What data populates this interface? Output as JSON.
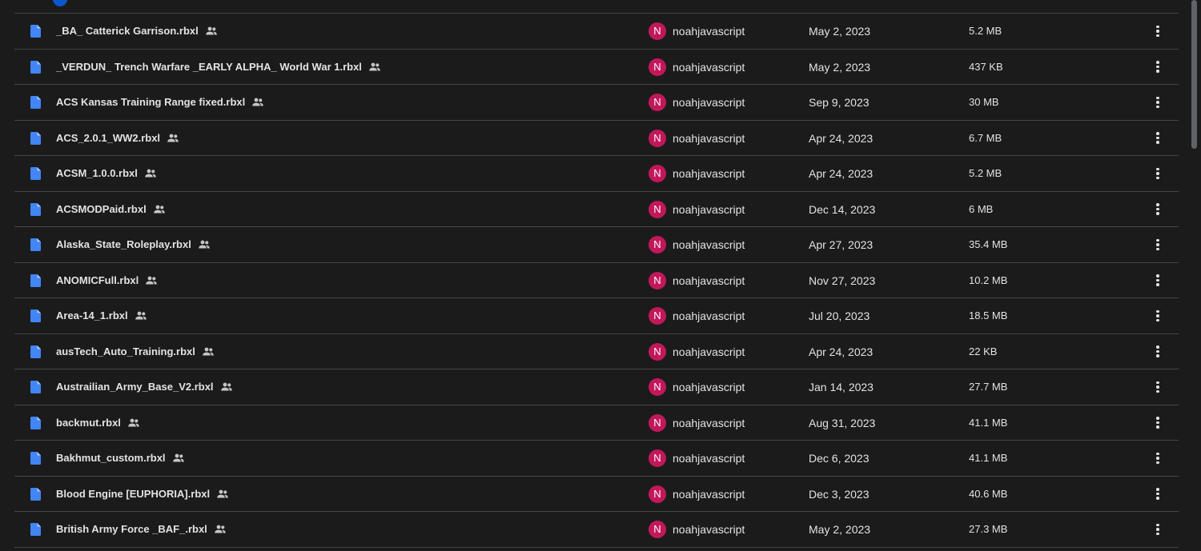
{
  "colors": {
    "background": "#1b1b1b",
    "divider": "#444746",
    "file_icon": "#4285f4",
    "avatar": "#c2185b",
    "text": "#e3e3e3"
  },
  "files": [
    {
      "name": "_BA_ Catterick Garrison.rbxl",
      "owner_initial": "N",
      "owner": "noahjavascript",
      "modified": "May 2, 2023",
      "size": "5.2 MB",
      "icon": "document-icon",
      "shared": true
    },
    {
      "name": "_VERDUN_ Trench Warfare _EARLY ALPHA_ World War 1.rbxl",
      "owner_initial": "N",
      "owner": "noahjavascript",
      "modified": "May 2, 2023",
      "size": "437 KB",
      "icon": "document-icon",
      "shared": true
    },
    {
      "name": "ACS Kansas Training Range fixed.rbxl",
      "owner_initial": "N",
      "owner": "noahjavascript",
      "modified": "Sep 9, 2023",
      "size": "30 MB",
      "icon": "document-icon",
      "shared": true
    },
    {
      "name": "ACS_2.0.1_WW2.rbxl",
      "owner_initial": "N",
      "owner": "noahjavascript",
      "modified": "Apr 24, 2023",
      "size": "6.7 MB",
      "icon": "document-icon",
      "shared": true
    },
    {
      "name": "ACSM_1.0.0.rbxl",
      "owner_initial": "N",
      "owner": "noahjavascript",
      "modified": "Apr 24, 2023",
      "size": "5.2 MB",
      "icon": "document-icon",
      "shared": true
    },
    {
      "name": "ACSMODPaid.rbxl",
      "owner_initial": "N",
      "owner": "noahjavascript",
      "modified": "Dec 14, 2023",
      "size": "6 MB",
      "icon": "document-icon",
      "shared": true
    },
    {
      "name": "Alaska_State_Roleplay.rbxl",
      "owner_initial": "N",
      "owner": "noahjavascript",
      "modified": "Apr 27, 2023",
      "size": "35.4 MB",
      "icon": "document-icon",
      "shared": true
    },
    {
      "name": "ANOMICFull.rbxl",
      "owner_initial": "N",
      "owner": "noahjavascript",
      "modified": "Nov 27, 2023",
      "size": "10.2 MB",
      "icon": "document-icon",
      "shared": true
    },
    {
      "name": "Area-14_1.rbxl",
      "owner_initial": "N",
      "owner": "noahjavascript",
      "modified": "Jul 20, 2023",
      "size": "18.5 MB",
      "icon": "document-icon",
      "shared": true
    },
    {
      "name": "ausTech_Auto_Training.rbxl",
      "owner_initial": "N",
      "owner": "noahjavascript",
      "modified": "Apr 24, 2023",
      "size": "22 KB",
      "icon": "document-icon",
      "shared": true
    },
    {
      "name": "Austrailian_Army_Base_V2.rbxl",
      "owner_initial": "N",
      "owner": "noahjavascript",
      "modified": "Jan 14, 2023",
      "size": "27.7 MB",
      "icon": "document-icon",
      "shared": true
    },
    {
      "name": "backmut.rbxl",
      "owner_initial": "N",
      "owner": "noahjavascript",
      "modified": "Aug 31, 2023",
      "size": "41.1 MB",
      "icon": "document-icon",
      "shared": true
    },
    {
      "name": "Bakhmut_custom.rbxl",
      "owner_initial": "N",
      "owner": "noahjavascript",
      "modified": "Dec 6, 2023",
      "size": "41.1 MB",
      "icon": "document-icon",
      "shared": true
    },
    {
      "name": "Blood Engine [EUPHORIA].rbxl",
      "owner_initial": "N",
      "owner": "noahjavascript",
      "modified": "Dec 3, 2023",
      "size": "40.6 MB",
      "icon": "document-icon",
      "shared": true
    },
    {
      "name": "British Army Force _BAF_.rbxl",
      "owner_initial": "N",
      "owner": "noahjavascript",
      "modified": "May 2, 2023",
      "size": "27.3 MB",
      "icon": "document-icon",
      "shared": true
    }
  ]
}
